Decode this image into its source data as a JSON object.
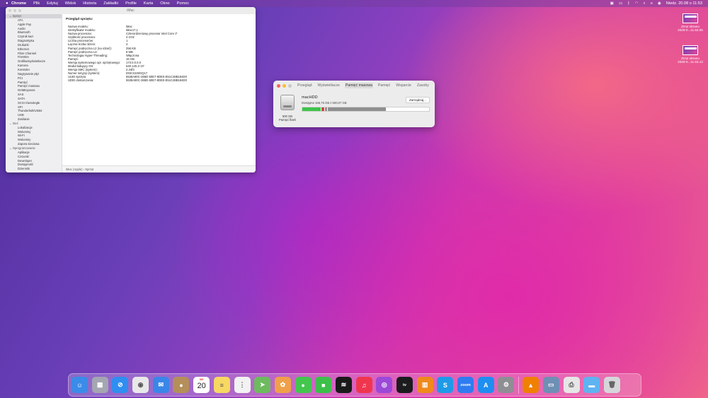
{
  "menubar": {
    "app": "Chrome",
    "items": [
      "Plik",
      "Edytuj",
      "Widok",
      "Historia",
      "Zakładki",
      "Profile",
      "Karta",
      "Okno",
      "Pomoc"
    ],
    "clock": "Niedz. 20.08 o 11:53"
  },
  "sysinfo": {
    "title": "iMac",
    "sidebar": [
      {
        "label": "Sprzęt",
        "cat": true,
        "sel": true
      },
      {
        "label": "ATA"
      },
      {
        "label": "Apple Pay"
      },
      {
        "label": "Audio"
      },
      {
        "label": "Bluetooth"
      },
      {
        "label": "Czytnik kart"
      },
      {
        "label": "Diagnostyka"
      },
      {
        "label": "Drukarki"
      },
      {
        "label": "Ethernet"
      },
      {
        "label": "Fibre Channel"
      },
      {
        "label": "FireWire"
      },
      {
        "label": "Grafika/wyświetlacze"
      },
      {
        "label": "Kamera"
      },
      {
        "label": "Kontroler"
      },
      {
        "label": "Nagrywanie płyt"
      },
      {
        "label": "PCI"
      },
      {
        "label": "Pamięć"
      },
      {
        "label": "Pamięć masowa"
      },
      {
        "label": "NVMExpress"
      },
      {
        "label": "SAS"
      },
      {
        "label": "SATA"
      },
      {
        "label": "SCSI równoległe"
      },
      {
        "label": "SPI"
      },
      {
        "label": "Thunderbolt/USB4"
      },
      {
        "label": "USB"
      },
      {
        "label": "Zasilanie"
      },
      {
        "label": "Sieć",
        "cat": true
      },
      {
        "label": "Lokalizacje"
      },
      {
        "label": "Woluminy"
      },
      {
        "label": "Wi-Fi"
      },
      {
        "label": "Woluminy"
      },
      {
        "label": "Zapora sieciowa"
      },
      {
        "label": "Oprogramowanie",
        "cat": true
      },
      {
        "label": "Aplikacje"
      },
      {
        "label": "Czcionki"
      },
      {
        "label": "Deweloper"
      },
      {
        "label": "Dostępność"
      },
      {
        "label": "Dzienniki"
      }
    ],
    "heading": "Przegląd sprzętu:",
    "rows": [
      {
        "k": "Nazwa modelu:",
        "v": "iMac"
      },
      {
        "k": "Identyfikator modelu:",
        "v": "iMac17,1"
      },
      {
        "k": "Nazwa procesora:",
        "v": "Czterordzeniowy procesor Intel Core i7"
      },
      {
        "k": "Szybkość procesora:",
        "v": "4 GHz"
      },
      {
        "k": "Liczba procesorów:",
        "v": "1"
      },
      {
        "k": "Łączna liczba rdzeni:",
        "v": "4"
      },
      {
        "k": "Pamięć podręczna L2 (na rdzeń):",
        "v": "256 KB"
      },
      {
        "k": "Pamięć podręczna L3:",
        "v": "8 MB"
      },
      {
        "k": "Technologia Hyper-Threading:",
        "v": "Włączona"
      },
      {
        "k": "Pamięć:",
        "v": "16 GB"
      },
      {
        "k": "Wersja systemowego opr. sprzętowego:",
        "v": "173.0.0.0.0"
      },
      {
        "k": "Moduł ładujący OS:",
        "v": "540.120.3~37"
      },
      {
        "k": "Wersja SMC (system):",
        "v": "2.34f3"
      },
      {
        "k": "Numer seryjny (system):",
        "v": "DGKX228GQ17"
      },
      {
        "k": "UUID sprzętu:",
        "v": "5538A80C-365D-50E7-8DE0-E51C48B184D0"
      },
      {
        "k": "UDID dostarczania:",
        "v": "5538A80C-365D-50E7-8DE0-E51C48B184D0"
      }
    ],
    "status": "iMac (Apple) › Sprzęt"
  },
  "storage": {
    "tabs": [
      "Przegląd",
      "Wyświetlacze",
      "Pamięć masowa",
      "Pamięć",
      "Wsparcie",
      "Zasoby"
    ],
    "active_tab": 2,
    "drive_name": "macHDD",
    "available": "Dostępne 166,75 GB z 500,07 GB",
    "capacity": "500 GB",
    "type": "Pamięć flash",
    "manage": "Zarządzaj...",
    "segments": [
      {
        "color": "#3cc44a",
        "fraction": 0.145
      },
      {
        "color": "#d04545",
        "fraction": 0.03
      },
      {
        "color": "#8f8f8f",
        "fraction": 0.02
      },
      {
        "color": "#8f8f8f",
        "fraction": 0.465
      }
    ]
  },
  "desktop": [
    {
      "label1": "Zrzut ekranu",
      "label2": "2026-0...11.53.05"
    },
    {
      "label1": "Zrzut ekranu",
      "label2": "2026-0...11.53.13"
    }
  ],
  "dock": {
    "calendar": {
      "month": "SIE",
      "day": "20"
    },
    "apps": [
      {
        "name": "finder-icon",
        "color": "#3b8be8",
        "glyph": "☺"
      },
      {
        "name": "launchpad-icon",
        "color": "#a4a6b2",
        "glyph": "▦"
      },
      {
        "name": "safari-icon",
        "color": "#2f8ef0",
        "glyph": "⊘"
      },
      {
        "name": "chrome-icon",
        "color": "#e8e8e8",
        "glyph": "◉"
      },
      {
        "name": "mail-icon",
        "color": "#3a86e8",
        "glyph": "✉"
      },
      {
        "name": "contacts-icon",
        "color": "#b48f5a",
        "glyph": "●"
      },
      {
        "name": "calendar-icon",
        "color": "#ffffff",
        "glyph": ""
      },
      {
        "name": "notes-icon",
        "color": "#f7d862",
        "glyph": "≡"
      },
      {
        "name": "reminders-icon",
        "color": "#f2f2f2",
        "glyph": "⋮"
      },
      {
        "name": "maps-icon",
        "color": "#6dbb5e",
        "glyph": "➤"
      },
      {
        "name": "photos-icon",
        "color": "#f0a04a",
        "glyph": "✿"
      },
      {
        "name": "messages-icon",
        "color": "#43c64e",
        "glyph": "●"
      },
      {
        "name": "facetime-icon",
        "color": "#3cc04a",
        "glyph": "■"
      },
      {
        "name": "spotify-icon",
        "color": "#1a1a1a",
        "glyph": "≋"
      },
      {
        "name": "music-icon",
        "color": "#f0364f",
        "glyph": "♫"
      },
      {
        "name": "podcasts-icon",
        "color": "#9c49d8",
        "glyph": "◎"
      },
      {
        "name": "appletv-icon",
        "color": "#1c1c1e",
        "glyph": "tv"
      },
      {
        "name": "books-icon",
        "color": "#f08a1c",
        "glyph": "▥"
      },
      {
        "name": "skype-icon",
        "color": "#1f9ae8",
        "glyph": "S"
      },
      {
        "name": "zoom-icon",
        "color": "#2f7cf0",
        "glyph": "zoom"
      },
      {
        "name": "appstore-icon",
        "color": "#1e8ef0",
        "glyph": "A"
      },
      {
        "name": "settings-icon",
        "color": "#8e8e93",
        "glyph": "⚙"
      },
      {
        "name": "vlc-icon",
        "color": "#f08000",
        "glyph": "▲"
      },
      {
        "name": "preview-icon",
        "color": "#6f8fb5",
        "glyph": "▭"
      },
      {
        "name": "printer-icon",
        "color": "#e6e6e6",
        "glyph": "⎙"
      },
      {
        "name": "downloads-folder-icon",
        "color": "#5fb3f0",
        "glyph": "▬"
      },
      {
        "name": "trash-icon",
        "color": "#d6d6da",
        "glyph": "🗑"
      }
    ]
  }
}
